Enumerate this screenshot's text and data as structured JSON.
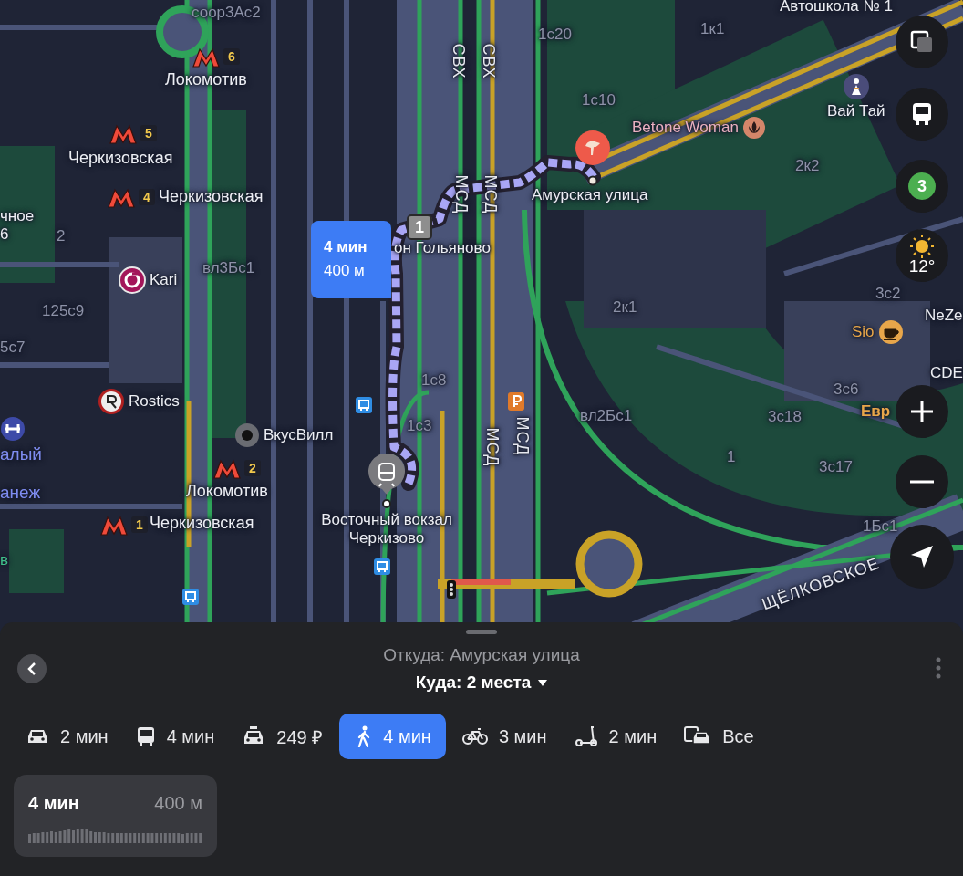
{
  "map": {
    "labels": [
      {
        "kind": "building",
        "text": "соор3Ас2"
      },
      {
        "kind": "place",
        "text": "Автошкола № 1"
      },
      {
        "kind": "building",
        "text": "1к1"
      },
      {
        "kind": "building",
        "text": "1с20"
      },
      {
        "kind": "building",
        "text": "1с10"
      },
      {
        "kind": "building",
        "text": "2к2"
      },
      {
        "kind": "place",
        "text": "чное"
      },
      {
        "kind": "place",
        "text": "6"
      },
      {
        "kind": "building",
        "text": "2"
      },
      {
        "kind": "building",
        "text": "вл3Бс1"
      },
      {
        "kind": "building",
        "text": "2к1"
      },
      {
        "kind": "building",
        "text": "3с2"
      },
      {
        "kind": "building",
        "text": "125с9"
      },
      {
        "kind": "place",
        "text": "NeZe"
      },
      {
        "kind": "building",
        "text": "5с7"
      },
      {
        "kind": "place",
        "text": "CDE"
      },
      {
        "kind": "building",
        "text": "1с8"
      },
      {
        "kind": "building",
        "text": "3с6"
      },
      {
        "kind": "building",
        "text": "1с3"
      },
      {
        "kind": "building",
        "text": "вл2Бс1"
      },
      {
        "kind": "building",
        "text": "3с18"
      },
      {
        "kind": "shop",
        "text": "Евр"
      },
      {
        "kind": "sport",
        "text": "алый"
      },
      {
        "kind": "building",
        "text": "1"
      },
      {
        "kind": "building",
        "text": "3с17"
      },
      {
        "kind": "sport",
        "text": "анеж"
      },
      {
        "kind": "building",
        "text": "1Бс1"
      },
      {
        "kind": "park",
        "text": "в"
      },
      {
        "kind": "road",
        "text": "СВХ"
      },
      {
        "kind": "road",
        "text": "СВХ"
      },
      {
        "kind": "road",
        "text": "МСД"
      },
      {
        "kind": "road",
        "text": "МСД"
      },
      {
        "kind": "road",
        "text": "МСД"
      },
      {
        "kind": "road",
        "text": "МСД"
      },
      {
        "kind": "road",
        "text": "ЩЁЛКОВСКОЕ"
      },
      {
        "kind": "place",
        "text": "Амурская улица"
      },
      {
        "kind": "place",
        "text": "он Гольяново"
      },
      {
        "kind": "place",
        "text": "Восточный вокзал Черкизово"
      }
    ],
    "pois": [
      {
        "kind": "beauty",
        "name": "Betone Woman"
      },
      {
        "kind": "massage",
        "name": "Вай Тай"
      },
      {
        "kind": "clothing",
        "name": "Kari"
      },
      {
        "kind": "fastfood",
        "name": "Rostics"
      },
      {
        "kind": "grocery",
        "name": "ВкусВилл"
      },
      {
        "kind": "cafe",
        "name": "Sio"
      }
    ],
    "metro": [
      {
        "line": "6",
        "name": "Локомотив"
      },
      {
        "line": "5",
        "name": "Черкизовская"
      },
      {
        "line": "4",
        "name": "Черкизовская"
      },
      {
        "line": "2",
        "name": "Локомотив"
      },
      {
        "line": "1",
        "name": "Черкизовская"
      }
    ],
    "route": {
      "time": "4 мин",
      "distance": "400 м",
      "step": "1"
    },
    "controls": {
      "traffic_score": "3",
      "temperature": "12°"
    }
  },
  "sheet": {
    "from": "Откуда: Амурская улица",
    "to": "Куда: 2 места",
    "modes": [
      {
        "kind": "car",
        "label": "2 мин",
        "selected": false
      },
      {
        "kind": "bus",
        "label": "4 мин",
        "selected": false
      },
      {
        "kind": "taxi",
        "label": "249 ₽",
        "selected": false
      },
      {
        "kind": "walk",
        "label": "4 мин",
        "selected": true
      },
      {
        "kind": "bike",
        "label": "3 мин",
        "selected": false
      },
      {
        "kind": "scooter",
        "label": "2 мин",
        "selected": false
      },
      {
        "kind": "all",
        "label": "Все",
        "selected": false
      }
    ],
    "summary": {
      "time": "4 мин",
      "distance": "400 м"
    }
  }
}
